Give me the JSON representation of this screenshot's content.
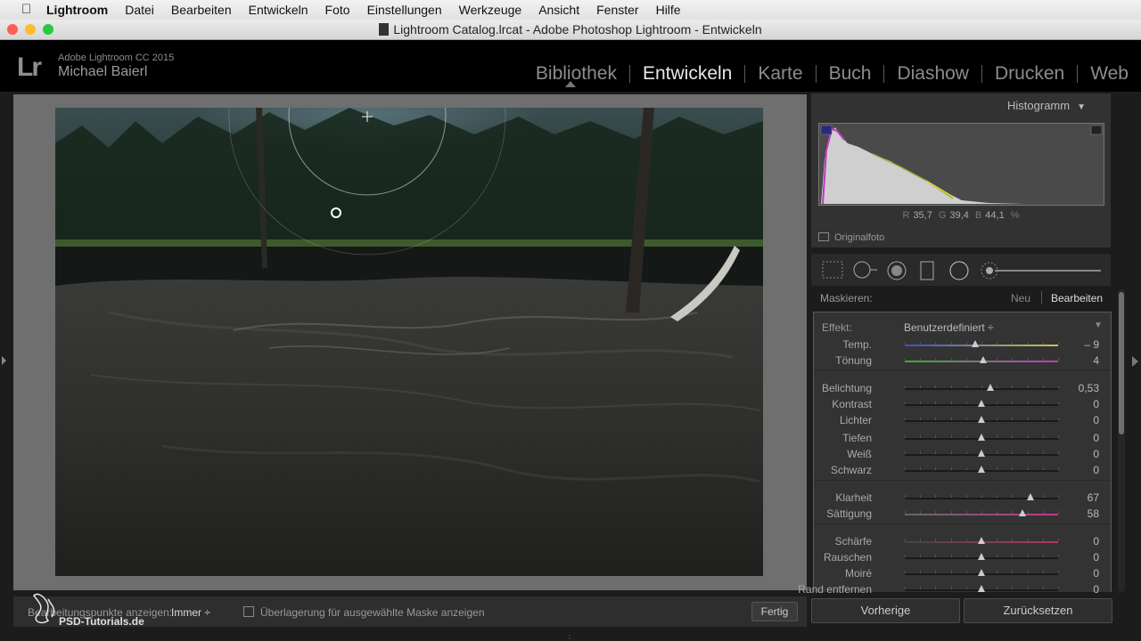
{
  "menubar": {
    "items": [
      "Lightroom",
      "Datei",
      "Bearbeiten",
      "Entwickeln",
      "Foto",
      "Einstellungen",
      "Werkzeuge",
      "Ansicht",
      "Fenster",
      "Hilfe"
    ]
  },
  "window": {
    "title": "Lightroom Catalog.lrcat - Adobe Photoshop Lightroom - Entwickeln",
    "buttons": {
      "close": "#fd5f57",
      "minimize": "#febc2e",
      "zoom": "#28c840"
    }
  },
  "identity": {
    "logo": "Lr",
    "product": "Adobe Lightroom CC 2015",
    "user": "Michael Baierl"
  },
  "modules": [
    "Bibliothek",
    "Entwickeln",
    "Karte",
    "Buch",
    "Diashow",
    "Drucken",
    "Web"
  ],
  "active_module": "Entwickeln",
  "histogram": {
    "title": "Histogramm",
    "r_label": "R",
    "r_value": "35,7",
    "g_label": "G",
    "g_value": "39,4",
    "b_label": "B",
    "b_value": "44,1",
    "unit": "%",
    "original_label": "Originalfoto"
  },
  "tools": [
    "crop-overlay-icon",
    "spot-removal-icon",
    "red-eye-icon",
    "graduated-filter-icon",
    "radial-filter-icon",
    "adjustment-brush-icon"
  ],
  "mask": {
    "label": "Maskieren:",
    "new": "Neu",
    "edit": "Bearbeiten"
  },
  "effect": {
    "label": "Effekt:",
    "value": "Benutzerdefiniert ÷"
  },
  "sliders": [
    {
      "label": "Temp.",
      "value": "– 9",
      "pos": 0.46
    },
    {
      "label": "Tönung",
      "value": "4",
      "pos": 0.51
    },
    {
      "label": "Belichtung",
      "value": "0,53",
      "pos": 0.56
    },
    {
      "label": "Kontrast",
      "value": "0",
      "pos": 0.5
    },
    {
      "label": "Lichter",
      "value": "0",
      "pos": 0.5
    },
    {
      "label": "Tiefen",
      "value": "0",
      "pos": 0.5
    },
    {
      "label": "Weiß",
      "value": "0",
      "pos": 0.5
    },
    {
      "label": "Schwarz",
      "value": "0",
      "pos": 0.5
    },
    {
      "label": "Klarheit",
      "value": "67",
      "pos": 0.82
    },
    {
      "label": "Sättigung",
      "value": "58",
      "pos": 0.77
    },
    {
      "label": "Schärfe",
      "value": "0",
      "pos": 0.5
    },
    {
      "label": "Rauschen",
      "value": "0",
      "pos": 0.5
    },
    {
      "label": "Moiré",
      "value": "0",
      "pos": 0.5
    },
    {
      "label": "Rand entfernen",
      "value": "0",
      "pos": 0.5
    }
  ],
  "buttons": {
    "previous": "Vorherige",
    "reset": "Zurücksetzen",
    "done": "Fertig"
  },
  "toolbar": {
    "show_pins_label": "Bearbeitungspunkte anzeigen:",
    "show_pins_value": "Immer ÷",
    "overlay_label": "Überlagerung für ausgewählte Maske anzeigen"
  },
  "watermark": "PSD-Tutorials.de"
}
